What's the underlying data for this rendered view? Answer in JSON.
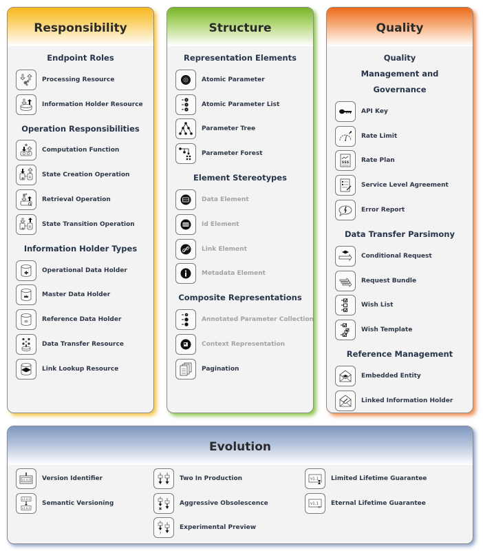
{
  "panels": {
    "responsibility": {
      "title": "Responsibility",
      "accent": "#f6b81c",
      "sections": [
        {
          "title": "Endpoint Roles",
          "items": [
            {
              "label": "Processing Resource",
              "icon": "processing-resource-icon",
              "enabled": true
            },
            {
              "label": "Information Holder Resource",
              "icon": "information-holder-resource-icon",
              "enabled": true
            }
          ]
        },
        {
          "title": "Operation Responsibilities",
          "items": [
            {
              "label": "Computation Function",
              "icon": "computation-function-icon",
              "enabled": true
            },
            {
              "label": "State Creation Operation",
              "icon": "state-creation-operation-icon",
              "enabled": true
            },
            {
              "label": "Retrieval Operation",
              "icon": "retrieval-operation-icon",
              "enabled": true
            },
            {
              "label": "State Transition Operation",
              "icon": "state-transition-operation-icon",
              "enabled": true
            }
          ]
        },
        {
          "title": "Information Holder Types",
          "items": [
            {
              "label": "Operational Data Holder",
              "icon": "operational-data-holder-icon",
              "enabled": true
            },
            {
              "label": "Master Data Holder",
              "icon": "master-data-holder-icon",
              "enabled": true
            },
            {
              "label": "Reference Data Holder",
              "icon": "reference-data-holder-icon",
              "enabled": true
            },
            {
              "label": "Data Transfer Resource",
              "icon": "data-transfer-resource-icon",
              "enabled": true
            },
            {
              "label": "Link Lookup Resource",
              "icon": "link-lookup-resource-icon",
              "enabled": true
            }
          ]
        }
      ]
    },
    "structure": {
      "title": "Structure",
      "accent": "#78b628",
      "sections": [
        {
          "title": "Representation Elements",
          "items": [
            {
              "label": "Atomic Parameter",
              "icon": "atomic-parameter-icon",
              "enabled": true
            },
            {
              "label": "Atomic Parameter List",
              "icon": "atomic-parameter-list-icon",
              "enabled": true
            },
            {
              "label": "Parameter Tree",
              "icon": "parameter-tree-icon",
              "enabled": true
            },
            {
              "label": "Parameter Forest",
              "icon": "parameter-forest-icon",
              "enabled": true
            }
          ]
        },
        {
          "title": "Element Stereotypes",
          "items": [
            {
              "label": "Data Element",
              "icon": "data-element-icon",
              "enabled": false
            },
            {
              "label": "Id Element",
              "icon": "id-element-icon",
              "enabled": false
            },
            {
              "label": "Link Element",
              "icon": "link-element-icon",
              "enabled": false
            },
            {
              "label": "Metadata Element",
              "icon": "metadata-element-icon",
              "enabled": false
            }
          ]
        },
        {
          "title": "Composite Representations",
          "items": [
            {
              "label": "Annotated Parameter Collection",
              "icon": "annotated-parameter-collection-icon",
              "enabled": false
            },
            {
              "label": "Context Representation",
              "icon": "context-representation-icon",
              "enabled": false
            },
            {
              "label": "Pagination",
              "icon": "pagination-icon",
              "enabled": true
            }
          ]
        }
      ]
    },
    "quality": {
      "title": "Quality",
      "accent": "#ec6a1a",
      "sections": [
        {
          "title": "Quality Management and Governance",
          "items": [
            {
              "label": "API Key",
              "icon": "key-icon",
              "enabled": true
            },
            {
              "label": "Rate Limit",
              "icon": "gauge-icon",
              "enabled": true
            },
            {
              "label": "Rate Plan",
              "icon": "rate-plan-icon",
              "enabled": true
            },
            {
              "label": "Service Level Agreement",
              "icon": "sla-document-icon",
              "enabled": true
            },
            {
              "label": "Error Report",
              "icon": "error-report-icon",
              "enabled": true
            }
          ]
        },
        {
          "title": "Data Transfer Parsimony",
          "items": [
            {
              "label": "Conditional Request",
              "icon": "conditional-request-icon",
              "enabled": true
            },
            {
              "label": "Request Bundle",
              "icon": "request-bundle-icon",
              "enabled": true
            },
            {
              "label": "Wish List",
              "icon": "wish-list-icon",
              "enabled": true
            },
            {
              "label": "Wish Template",
              "icon": "wish-template-icon",
              "enabled": true
            }
          ]
        },
        {
          "title": "Reference Management",
          "items": [
            {
              "label": "Embedded Entity",
              "icon": "embedded-entity-icon",
              "enabled": true
            },
            {
              "label": "Linked Information Holder",
              "icon": "linked-information-holder-icon",
              "enabled": true
            }
          ]
        }
      ]
    },
    "evolution": {
      "title": "Evolution",
      "accent": "#7f97c0",
      "columns": [
        [
          {
            "label": "Version Identifier",
            "icon": "version-identifier-icon",
            "enabled": true
          },
          {
            "label": "Semantic Versioning",
            "icon": "semantic-versioning-icon",
            "enabled": true
          }
        ],
        [
          {
            "label": "Two In Production",
            "icon": "two-in-production-icon",
            "enabled": true
          },
          {
            "label": "Aggressive Obsolescence",
            "icon": "aggressive-obsolescence-icon",
            "enabled": true
          },
          {
            "label": "Experimental Preview",
            "icon": "experimental-preview-icon",
            "enabled": true
          }
        ],
        [
          {
            "label": "Limited Lifetime Guarantee",
            "icon": "limited-lifetime-guarantee-icon",
            "enabled": true
          },
          {
            "label": "Eternal Lifetime Guarantee",
            "icon": "eternal-lifetime-guarantee-icon",
            "enabled": true
          }
        ]
      ],
      "icon_text": {
        "v100": "v1.0.0",
        "v101": "v1.0.1",
        "v11": "v1.1"
      }
    }
  }
}
